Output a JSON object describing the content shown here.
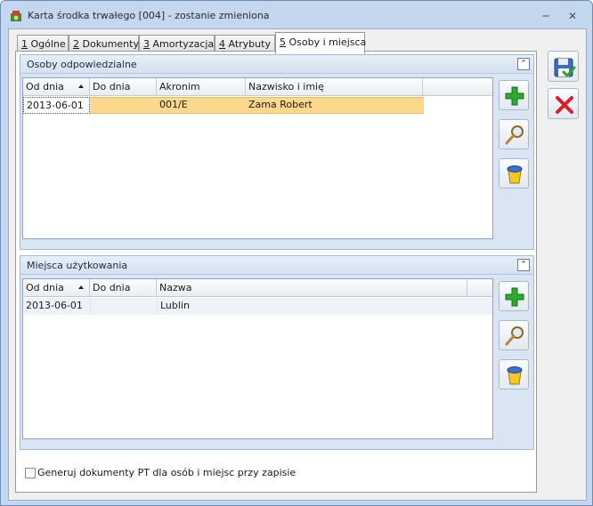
{
  "window": {
    "title": "Karta środka trwałego [004] - zostanie zmieniona"
  },
  "tabs": [
    {
      "num": "1",
      "label": "Ogólne"
    },
    {
      "num": "2",
      "label": "Dokumenty"
    },
    {
      "num": "3",
      "label": "Amortyzacja"
    },
    {
      "num": "4",
      "label": "Atrybuty"
    },
    {
      "num": "5",
      "label": "Osoby i miejsca"
    }
  ],
  "active_tab": "5 Osoby i miejsca",
  "persons": {
    "title": "Osoby odpowiedzialne",
    "columns": [
      "Od dnia",
      "Do dnia",
      "Akronim",
      "Nazwisko i imię"
    ],
    "rows": [
      {
        "from": "2013-06-01",
        "to": "",
        "akronim": "001/E",
        "name": "Zama Robert"
      }
    ]
  },
  "places": {
    "title": "Miejsca użytkowania",
    "columns": [
      "Od dnia",
      "Do dnia",
      "Nazwa"
    ],
    "rows": [
      {
        "from": "2013-06-01",
        "to": "",
        "name": "Lublin"
      }
    ]
  },
  "checkbox": {
    "label": "Generuj dokumenty PT dla osób i miejsc przy zapisie",
    "checked": false
  },
  "icons": {
    "add": "plus-icon",
    "view": "magnifier-icon",
    "delete": "bin-icon",
    "save": "floppy-save-icon",
    "close": "red-x-icon"
  },
  "colors": {
    "selected_row": "#fbd88c",
    "group_bg": "#d9e5f3"
  }
}
